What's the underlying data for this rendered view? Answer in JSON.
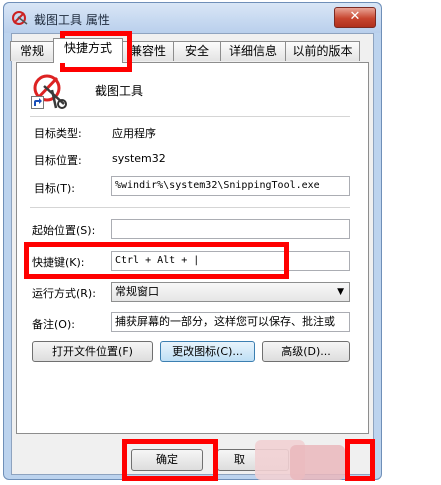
{
  "window": {
    "title": "截图工具 属性",
    "close_glyph": "✕"
  },
  "tabs": [
    "常规",
    "快捷方式",
    "兼容性",
    "安全",
    "详细信息",
    "以前的版本"
  ],
  "header": {
    "app_name": "截图工具"
  },
  "rows": {
    "target_type_label": "目标类型:",
    "target_type_value": "应用程序",
    "target_location_label": "目标位置:",
    "target_location_value": "system32",
    "target_label": "目标(T):",
    "target_value": "%windir%\\system32\\SnippingTool.exe",
    "start_in_label": "起始位置(S):",
    "start_in_value": "",
    "shortcut_key_label": "快捷键(K):",
    "shortcut_key_value": "Ctrl + Alt + |",
    "run_label": "运行方式(R):",
    "run_value": "常规窗口",
    "comment_label": "备注(O):",
    "comment_value": "捕获屏幕的一部分，这样您可以保存、批注或"
  },
  "buttons": {
    "open_location": "打开文件位置(F)",
    "change_icon": "更改图标(C)...",
    "advanced": "高级(D)...",
    "ok": "确定",
    "cancel": "取"
  },
  "colors": {
    "highlight": "#ff0000",
    "window_frame": "#bcd3ee"
  },
  "icons": [
    "snipping-tool-icon",
    "shortcut-arrow-icon",
    "dropdown-arrow-icon",
    "close-icon"
  ]
}
